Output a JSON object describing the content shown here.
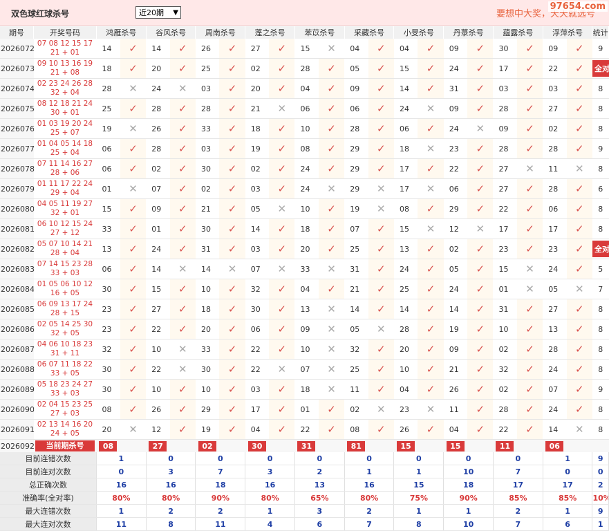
{
  "header": {
    "title": "双色球红球杀号",
    "period_select": "近20期",
    "slogan": "要想中大奖，天天就选号",
    "watermark": "97654.com"
  },
  "columns": {
    "period": "期号",
    "draw": "开奖号码",
    "experts": [
      "鸿雁杀号",
      "谷风杀号",
      "周南杀号",
      "蓬之杀号",
      "苯苡杀号",
      "采藏杀号",
      "小旻杀号",
      "丹菉杀号",
      "蕴露杀号",
      "浮萍杀号"
    ],
    "stats": "统计"
  },
  "rows": [
    {
      "id": "2026072",
      "draw": [
        "07 08 12 15 17",
        "21 + 01"
      ],
      "picks": [
        "14",
        "14",
        "26",
        "27",
        "15",
        "04",
        "04",
        "09",
        "30",
        "09"
      ],
      "hits": [
        1,
        1,
        1,
        1,
        0,
        1,
        1,
        1,
        1,
        1
      ],
      "stat": "9"
    },
    {
      "id": "2026073",
      "draw": [
        "09 10 13 16 19",
        "21 + 08"
      ],
      "picks": [
        "18",
        "20",
        "25",
        "02",
        "28",
        "05",
        "15",
        "24",
        "17",
        "22"
      ],
      "hits": [
        1,
        1,
        1,
        1,
        1,
        1,
        1,
        1,
        1,
        1
      ],
      "stat": "全对"
    },
    {
      "id": "2026074",
      "draw": [
        "02 23 24 26 28",
        "32 + 04"
      ],
      "picks": [
        "28",
        "24",
        "03",
        "20",
        "04",
        "09",
        "14",
        "31",
        "03",
        "03"
      ],
      "hits": [
        0,
        0,
        1,
        1,
        1,
        1,
        1,
        1,
        1,
        1
      ],
      "stat": "8"
    },
    {
      "id": "2026075",
      "draw": [
        "08 12 18 21 24",
        "30 + 01"
      ],
      "picks": [
        "25",
        "28",
        "28",
        "21",
        "06",
        "06",
        "24",
        "09",
        "28",
        "27"
      ],
      "hits": [
        1,
        1,
        1,
        0,
        1,
        1,
        0,
        1,
        1,
        1
      ],
      "stat": "8"
    },
    {
      "id": "2026076",
      "draw": [
        "01 03 19 20 24",
        "25 + 07"
      ],
      "picks": [
        "19",
        "26",
        "33",
        "18",
        "10",
        "28",
        "06",
        "24",
        "09",
        "02"
      ],
      "hits": [
        0,
        1,
        1,
        1,
        1,
        1,
        1,
        0,
        1,
        1
      ],
      "stat": "8"
    },
    {
      "id": "2026077",
      "draw": [
        "01 04 05 14 18",
        "25 + 04"
      ],
      "picks": [
        "06",
        "28",
        "03",
        "19",
        "08",
        "29",
        "18",
        "23",
        "28",
        "28"
      ],
      "hits": [
        1,
        1,
        1,
        1,
        1,
        1,
        0,
        1,
        1,
        1
      ],
      "stat": "9"
    },
    {
      "id": "2026078",
      "draw": [
        "07 11 14 16 27",
        "28 + 06"
      ],
      "picks": [
        "06",
        "02",
        "30",
        "02",
        "24",
        "29",
        "17",
        "22",
        "27",
        "11"
      ],
      "hits": [
        1,
        1,
        1,
        1,
        1,
        1,
        1,
        1,
        0,
        0
      ],
      "stat": "8"
    },
    {
      "id": "2026079",
      "draw": [
        "01 11 17 22 24",
        "29 + 04"
      ],
      "picks": [
        "01",
        "07",
        "02",
        "03",
        "24",
        "29",
        "17",
        "06",
        "27",
        "28"
      ],
      "hits": [
        0,
        1,
        1,
        1,
        0,
        0,
        0,
        1,
        1,
        1
      ],
      "stat": "6"
    },
    {
      "id": "2026080",
      "draw": [
        "04 05 11 19 27",
        "32 + 01"
      ],
      "picks": [
        "15",
        "09",
        "21",
        "05",
        "10",
        "19",
        "08",
        "29",
        "22",
        "06"
      ],
      "hits": [
        1,
        1,
        1,
        0,
        1,
        0,
        1,
        1,
        1,
        1
      ],
      "stat": "8"
    },
    {
      "id": "2026081",
      "draw": [
        "06 10 12 15 24",
        "27 + 12"
      ],
      "picks": [
        "33",
        "01",
        "30",
        "14",
        "18",
        "07",
        "15",
        "12",
        "17",
        "17"
      ],
      "hits": [
        1,
        1,
        1,
        1,
        1,
        1,
        0,
        0,
        1,
        1
      ],
      "stat": "8"
    },
    {
      "id": "2026082",
      "draw": [
        "05 07 10 14 21",
        "28 + 04"
      ],
      "picks": [
        "13",
        "24",
        "31",
        "03",
        "20",
        "25",
        "13",
        "02",
        "23",
        "23"
      ],
      "hits": [
        1,
        1,
        1,
        1,
        1,
        1,
        1,
        1,
        1,
        1
      ],
      "stat": "全对"
    },
    {
      "id": "2026083",
      "draw": [
        "07 14 15 23 28",
        "33 + 03"
      ],
      "picks": [
        "06",
        "14",
        "14",
        "07",
        "33",
        "31",
        "24",
        "05",
        "15",
        "24"
      ],
      "hits": [
        1,
        0,
        0,
        0,
        0,
        1,
        1,
        1,
        0,
        1
      ],
      "stat": "5"
    },
    {
      "id": "2026084",
      "draw": [
        "01 05 06 10 12",
        "16 + 05"
      ],
      "picks": [
        "30",
        "15",
        "10",
        "32",
        "04",
        "21",
        "25",
        "24",
        "01",
        "05"
      ],
      "hits": [
        1,
        1,
        1,
        1,
        1,
        1,
        1,
        1,
        0,
        0
      ],
      "stat": "7"
    },
    {
      "id": "2026085",
      "draw": [
        "06 09 13 17 24",
        "28 + 15"
      ],
      "picks": [
        "23",
        "27",
        "18",
        "30",
        "13",
        "14",
        "14",
        "14",
        "31",
        "27"
      ],
      "hits": [
        1,
        1,
        1,
        1,
        0,
        1,
        1,
        1,
        1,
        1
      ],
      "stat": "8"
    },
    {
      "id": "2026086",
      "draw": [
        "02 05 14 25 30",
        "32 + 05"
      ],
      "picks": [
        "23",
        "22",
        "20",
        "06",
        "09",
        "05",
        "28",
        "19",
        "10",
        "13"
      ],
      "hits": [
        1,
        1,
        1,
        1,
        0,
        0,
        1,
        1,
        1,
        1
      ],
      "stat": "8"
    },
    {
      "id": "2026087",
      "draw": [
        "04 06 10 18 23",
        "31 + 11"
      ],
      "picks": [
        "32",
        "10",
        "33",
        "22",
        "10",
        "32",
        "20",
        "09",
        "02",
        "28"
      ],
      "hits": [
        1,
        0,
        1,
        1,
        0,
        1,
        1,
        1,
        1,
        1
      ],
      "stat": "8"
    },
    {
      "id": "2026088",
      "draw": [
        "06 07 11 18 22",
        "33 + 05"
      ],
      "picks": [
        "30",
        "22",
        "30",
        "22",
        "07",
        "25",
        "10",
        "21",
        "32",
        "24"
      ],
      "hits": [
        1,
        0,
        1,
        0,
        0,
        1,
        1,
        1,
        1,
        1
      ],
      "stat": "8"
    },
    {
      "id": "2026089",
      "draw": [
        "05 18 23 24 27",
        "33 + 03"
      ],
      "picks": [
        "30",
        "10",
        "10",
        "03",
        "18",
        "11",
        "04",
        "26",
        "02",
        "07"
      ],
      "hits": [
        1,
        1,
        1,
        1,
        0,
        1,
        1,
        1,
        1,
        1
      ],
      "stat": "9"
    },
    {
      "id": "2026090",
      "draw": [
        "02 04 15 23 25",
        "27 + 03"
      ],
      "picks": [
        "08",
        "26",
        "29",
        "17",
        "01",
        "02",
        "23",
        "11",
        "28",
        "24"
      ],
      "hits": [
        1,
        1,
        1,
        1,
        1,
        0,
        0,
        1,
        1,
        1
      ],
      "stat": "8"
    },
    {
      "id": "2026091",
      "draw": [
        "02 13 14 16 20",
        "24 + 05"
      ],
      "picks": [
        "20",
        "12",
        "19",
        "04",
        "22",
        "08",
        "26",
        "04",
        "22",
        "14"
      ],
      "hits": [
        0,
        1,
        1,
        1,
        1,
        1,
        1,
        1,
        1,
        0
      ],
      "stat": "8"
    }
  ],
  "current": {
    "id": "2026092",
    "label": "当前期杀号",
    "picks": [
      "08",
      "27",
      "02",
      "30",
      "31",
      "81",
      "15",
      "15",
      "11",
      "06"
    ]
  },
  "summary": [
    {
      "label": "目前连错次数",
      "values": [
        "1",
        "0",
        "0",
        "0",
        "0",
        "0",
        "0",
        "0",
        "0",
        "1",
        "9"
      ]
    },
    {
      "label": "目前连对次数",
      "values": [
        "0",
        "3",
        "7",
        "3",
        "2",
        "1",
        "1",
        "10",
        "7",
        "0",
        "0"
      ]
    },
    {
      "label": "总正确次数",
      "values": [
        "16",
        "16",
        "18",
        "16",
        "13",
        "16",
        "15",
        "18",
        "17",
        "17",
        "2"
      ]
    },
    {
      "label": "准确率(全对率)",
      "values": [
        "80%",
        "80%",
        "90%",
        "80%",
        "65%",
        "80%",
        "75%",
        "90%",
        "85%",
        "85%",
        "10%"
      ]
    },
    {
      "label": "最大连错次数",
      "values": [
        "1",
        "2",
        "2",
        "1",
        "3",
        "2",
        "1",
        "1",
        "2",
        "1",
        "9"
      ]
    },
    {
      "label": "最大连对次数",
      "values": [
        "11",
        "8",
        "11",
        "4",
        "6",
        "7",
        "8",
        "10",
        "7",
        "6",
        "1"
      ]
    }
  ],
  "icons": {
    "hit": "check-icon",
    "miss": "cross-icon"
  },
  "colors": {
    "accent": "#d93a3a",
    "hit": "#d9534f",
    "miss": "#aaaaaa",
    "summary_num": "#1f3fa5",
    "header_bg": "#ffe8e8"
  }
}
